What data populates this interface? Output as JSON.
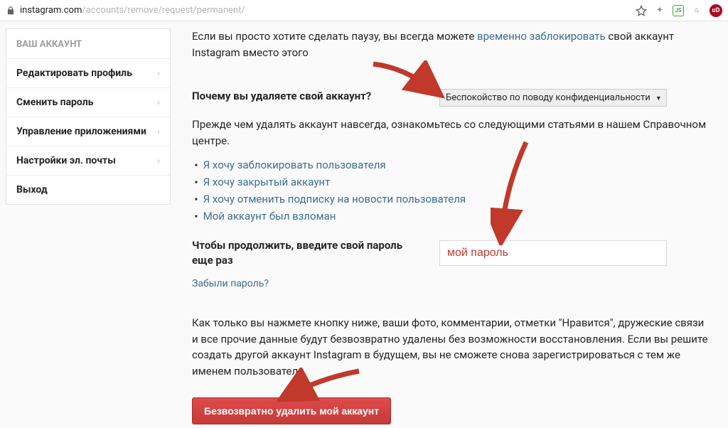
{
  "url": {
    "host": "instagram.com",
    "path": "/accounts/remove/request/permanent/"
  },
  "ext_labels": {
    "js": "JS",
    "ub": "uD"
  },
  "sidebar": {
    "header": "ВАШ АККАУНТ",
    "items": [
      {
        "label": "Редактировать профиль"
      },
      {
        "label": "Сменить пароль"
      },
      {
        "label": "Управление приложениями"
      },
      {
        "label": "Настройки эл. почты"
      },
      {
        "label": "Выход"
      }
    ]
  },
  "intro": {
    "pre": "Если вы просто хотите сделать паузу, вы всегда можете ",
    "link": "временно заблокировать",
    "post": " свой аккаунт Instagram вместо этого"
  },
  "reason": {
    "label": "Почему вы удаляете свой аккаунт?",
    "selected": "Беспокойство по поводу конфиденциальности"
  },
  "pre_delete_para": "Прежде чем удалять аккаунт навсегда, ознакомьтесь со следующими статьями в нашем Справочном центре.",
  "help_links": [
    "Я хочу заблокировать пользователя",
    "Я хочу закрытый аккаунт",
    "Я хочу отменить подписку на новости пользователя",
    "Мой аккаунт был взломан"
  ],
  "password": {
    "label": "Чтобы продолжить, введите свой пароль еще раз",
    "value": "мой пароль"
  },
  "forgot_link": "Забыли пароль?",
  "warning_para": "Как только вы нажмете кнопку ниже, ваши фото, комментарии, отметки \"Нравится\", дружеские связи и все прочие данные будут безвозвратно удалены без возможности восстановления. Если вы решите создать другой аккаунт Instagram в будущем, вы не сможете снова зарегистрироваться с тем же именем пользователя.",
  "delete_button": "Безвозвратно удалить мой аккаунт",
  "colors": {
    "arrow": "#c0392b"
  }
}
